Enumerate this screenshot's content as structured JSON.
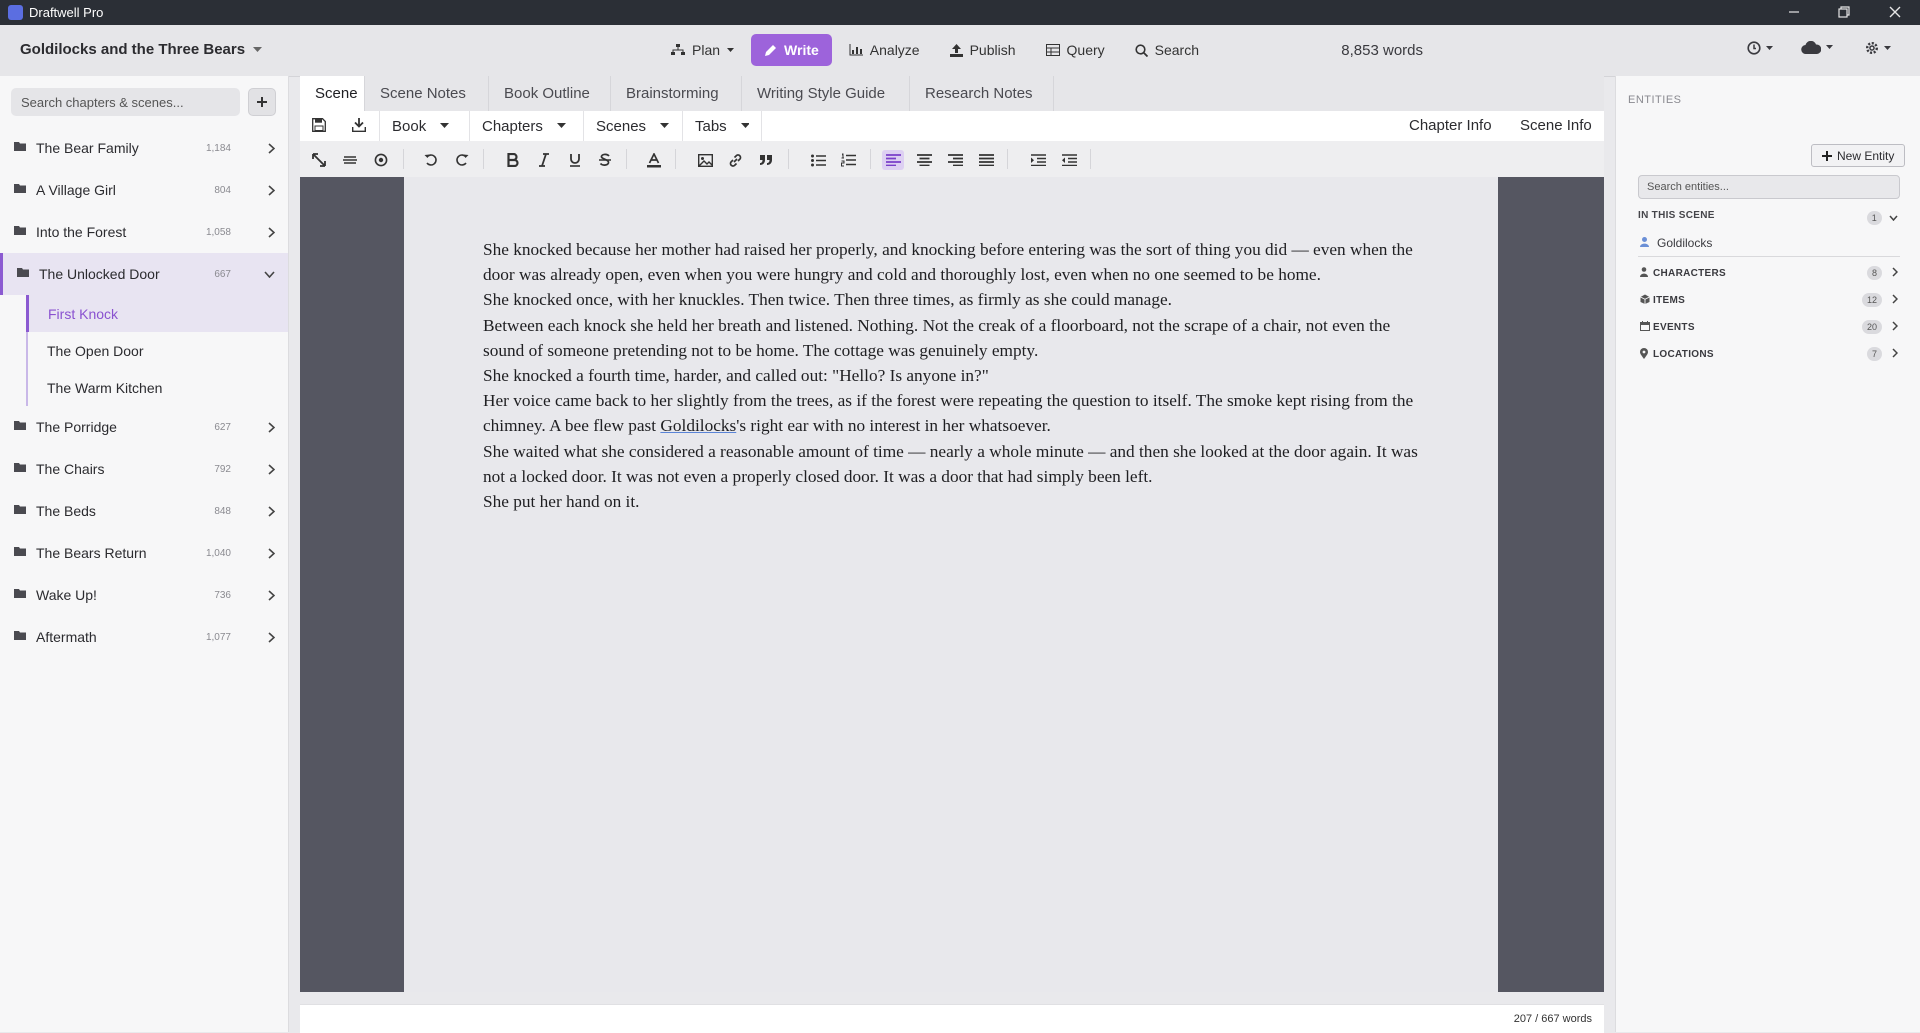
{
  "app": {
    "title": "Draftwell Pro"
  },
  "header": {
    "book_title": "Goldilocks and the Three Bears",
    "nav": [
      {
        "label": "Plan",
        "icon": "sitemap-icon"
      },
      {
        "label": "Write",
        "icon": "pencil-icon",
        "active": true
      },
      {
        "label": "Analyze",
        "icon": "bar-chart-icon"
      },
      {
        "label": "Publish",
        "icon": "upload-icon"
      },
      {
        "label": "Query",
        "icon": "table-icon"
      },
      {
        "label": "Search",
        "icon": "search-icon"
      }
    ],
    "word_count": "8,853 words"
  },
  "sidebar": {
    "search_placeholder": "Search chapters & scenes...",
    "chapters": [
      {
        "name": "The Bear Family",
        "count": "1,184"
      },
      {
        "name": "A Village Girl",
        "count": "804"
      },
      {
        "name": "Into the Forest",
        "count": "1,058"
      },
      {
        "name": "The Unlocked Door",
        "count": "667",
        "expanded": true,
        "scenes": [
          {
            "name": "First Knock",
            "active": true
          },
          {
            "name": "The Open Door"
          },
          {
            "name": "The Warm Kitchen"
          }
        ]
      },
      {
        "name": "The Porridge",
        "count": "627"
      },
      {
        "name": "The Chairs",
        "count": "792"
      },
      {
        "name": "The Beds",
        "count": "848"
      },
      {
        "name": "The Bears Return",
        "count": "1,040"
      },
      {
        "name": "Wake Up!",
        "count": "736"
      },
      {
        "name": "Aftermath",
        "count": "1,077"
      }
    ]
  },
  "tabs": [
    "Scene",
    "Scene Notes",
    "Book Outline",
    "Brainstorming",
    "Writing Style Guide",
    "Research Notes"
  ],
  "toolbar": {
    "dropdowns": [
      "Book",
      "Chapters",
      "Scenes",
      "Tabs"
    ],
    "chapter_info": "Chapter Info",
    "scene_info": "Scene Info"
  },
  "editor": {
    "paragraphs": [
      "She knocked because her mother had raised her properly, and knocking before entering was the sort of thing you did — even when the door was already open, even when you were hungry and cold and thoroughly lost, even when no one seemed to be home.",
      "She knocked once, with her knuckles. Then twice. Then three times, as firmly as she could manage.",
      "Between each knock she held her breath and listened. Nothing. Not the creak of a floorboard, not the scrape of a chair, not even the sound of someone pretending not to be home. The cottage was genuinely empty.",
      "She knocked a fourth time, harder, and called out: \"Hello? Is anyone in?\"",
      "Her voice came back to her slightly from the trees, as if the forest were repeating the question to itself. The smoke kept rising from the chimney. A bee flew past [[Goldilocks]]'s right ear with no interest in her whatsoever.",
      "She waited what she considered a reasonable amount of time — nearly a whole minute — and then she looked at the door again. It was not a locked door. It was not even a properly closed door. It was a door that had simply been left.",
      "She put her hand on it."
    ],
    "status": "207 / 667 words"
  },
  "entities": {
    "heading": "ENTITIES",
    "new_button": "New Entity",
    "search_placeholder": "Search entities...",
    "in_scene": {
      "label": "IN THIS SCENE",
      "count": "1",
      "items": [
        "Goldilocks"
      ]
    },
    "categories": [
      {
        "label": "CHARACTERS",
        "count": "8",
        "icon": "person-icon"
      },
      {
        "label": "ITEMS",
        "count": "12",
        "icon": "cube-icon"
      },
      {
        "label": "EVENTS",
        "count": "20",
        "icon": "calendar-icon"
      },
      {
        "label": "LOCATIONS",
        "count": "7",
        "icon": "map-pin-icon"
      }
    ]
  },
  "colors": {
    "accent": "#9d63db",
    "editor_bg": "#555661",
    "titlebar": "#2b2f36"
  }
}
